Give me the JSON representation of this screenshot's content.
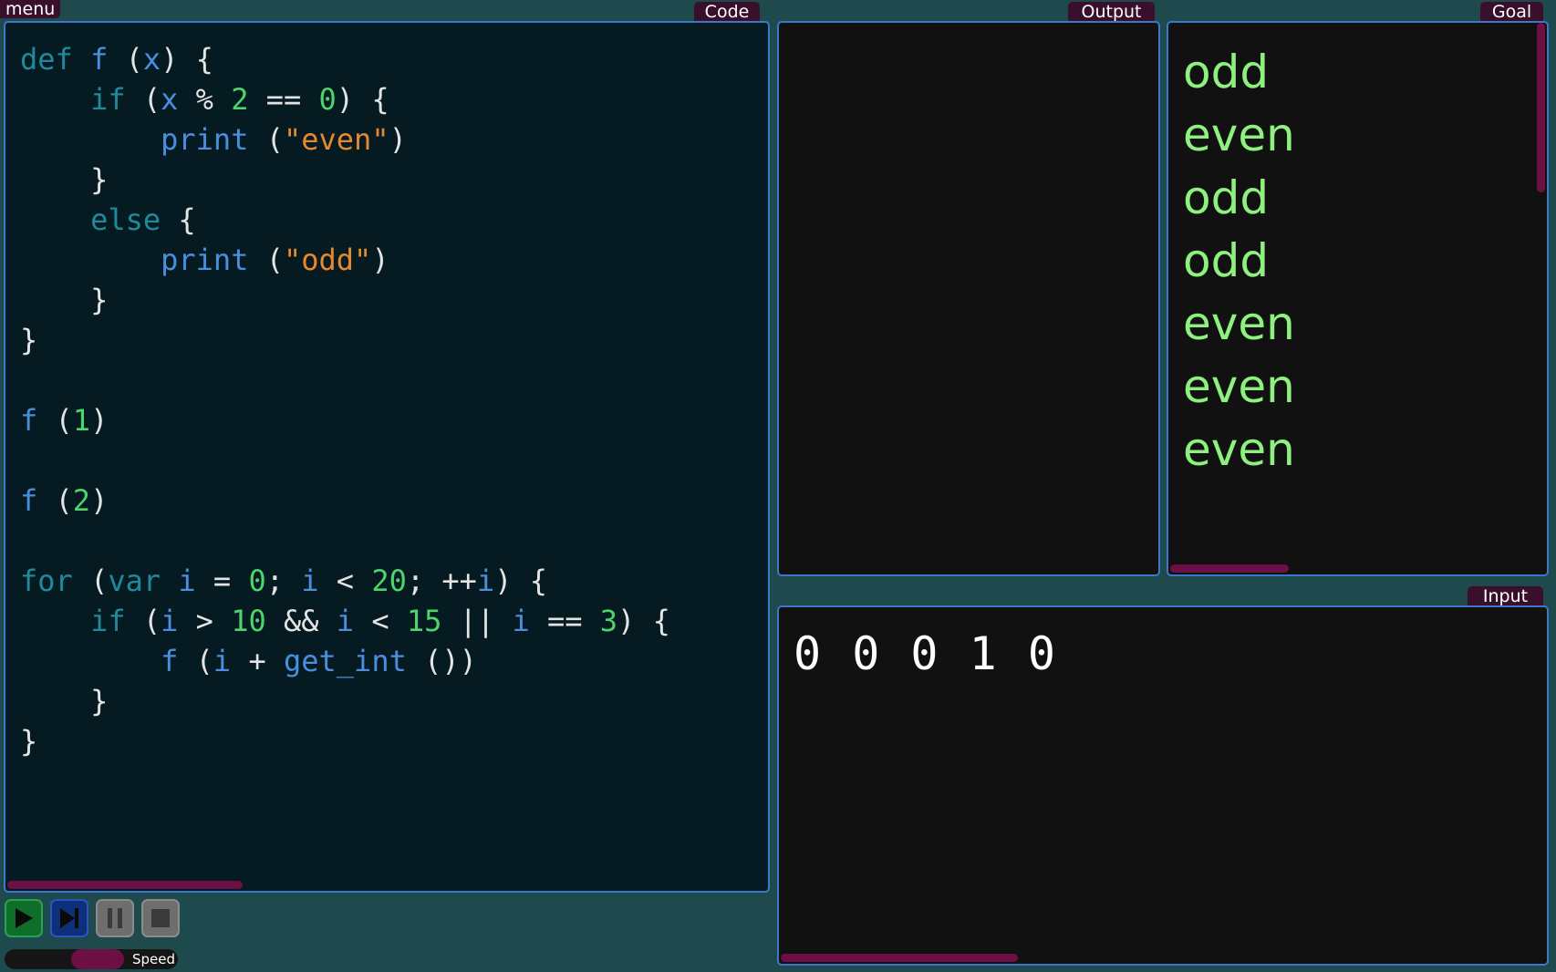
{
  "menu": {
    "label": "menu"
  },
  "tabs": {
    "code": "Code",
    "output": "Output",
    "goal": "Goal",
    "input": "Input"
  },
  "code": {
    "lines": [
      [
        {
          "t": "def",
          "c": "kw"
        },
        {
          "t": " "
        },
        {
          "t": "f",
          "c": "fn"
        },
        {
          "t": " ("
        },
        {
          "t": "x",
          "c": "fn"
        },
        {
          "t": ") {"
        }
      ],
      [
        {
          "t": "    "
        },
        {
          "t": "if",
          "c": "kw"
        },
        {
          "t": " ("
        },
        {
          "t": "x",
          "c": "fn"
        },
        {
          "t": " % "
        },
        {
          "t": "2",
          "c": "num"
        },
        {
          "t": " == "
        },
        {
          "t": "0",
          "c": "num"
        },
        {
          "t": ") {"
        }
      ],
      [
        {
          "t": "        "
        },
        {
          "t": "print",
          "c": "fn"
        },
        {
          "t": " ("
        },
        {
          "t": "\"even\"",
          "c": "str"
        },
        {
          "t": ")"
        }
      ],
      [
        {
          "t": "    }"
        }
      ],
      [
        {
          "t": "    "
        },
        {
          "t": "else",
          "c": "kw"
        },
        {
          "t": " {"
        }
      ],
      [
        {
          "t": "        "
        },
        {
          "t": "print",
          "c": "fn"
        },
        {
          "t": " ("
        },
        {
          "t": "\"odd\"",
          "c": "str"
        },
        {
          "t": ")"
        }
      ],
      [
        {
          "t": "    }"
        }
      ],
      [
        {
          "t": "}"
        }
      ],
      [],
      [
        {
          "t": "f",
          "c": "fn"
        },
        {
          "t": " ("
        },
        {
          "t": "1",
          "c": "num"
        },
        {
          "t": ")"
        }
      ],
      [],
      [
        {
          "t": "f",
          "c": "fn"
        },
        {
          "t": " ("
        },
        {
          "t": "2",
          "c": "num"
        },
        {
          "t": ")"
        }
      ],
      [],
      [
        {
          "t": "for",
          "c": "kw"
        },
        {
          "t": " ("
        },
        {
          "t": "var",
          "c": "kw"
        },
        {
          "t": " "
        },
        {
          "t": "i",
          "c": "fn"
        },
        {
          "t": " = "
        },
        {
          "t": "0",
          "c": "num"
        },
        {
          "t": "; "
        },
        {
          "t": "i",
          "c": "fn"
        },
        {
          "t": " < "
        },
        {
          "t": "20",
          "c": "num"
        },
        {
          "t": "; ++"
        },
        {
          "t": "i",
          "c": "fn"
        },
        {
          "t": ") {"
        }
      ],
      [
        {
          "t": "    "
        },
        {
          "t": "if",
          "c": "kw"
        },
        {
          "t": " ("
        },
        {
          "t": "i",
          "c": "fn"
        },
        {
          "t": " > "
        },
        {
          "t": "10",
          "c": "num"
        },
        {
          "t": " && "
        },
        {
          "t": "i",
          "c": "fn"
        },
        {
          "t": " < "
        },
        {
          "t": "15",
          "c": "num"
        },
        {
          "t": " || "
        },
        {
          "t": "i",
          "c": "fn"
        },
        {
          "t": " == "
        },
        {
          "t": "3",
          "c": "num"
        },
        {
          "t": ") {"
        }
      ],
      [
        {
          "t": "        "
        },
        {
          "t": "f",
          "c": "fn"
        },
        {
          "t": " ("
        },
        {
          "t": "i",
          "c": "fn"
        },
        {
          "t": " + "
        },
        {
          "t": "get_int",
          "c": "fn"
        },
        {
          "t": " ())"
        }
      ],
      [
        {
          "t": "    }"
        }
      ],
      [
        {
          "t": "}"
        }
      ]
    ]
  },
  "output": {
    "lines": []
  },
  "goal": {
    "lines": [
      "odd",
      "even",
      "odd",
      "odd",
      "even",
      "even",
      "even"
    ]
  },
  "input": {
    "text": "0 0 0 1 0"
  },
  "controls": {
    "run_icon": "play-icon",
    "step_icon": "step-forward-icon",
    "pause_icon": "pause-icon",
    "stop_icon": "stop-icon",
    "speed_label": "Speed",
    "speed_level": 0.55
  },
  "colors": {
    "background": "#1e4a4e",
    "panel_border": "#3b78c9",
    "tab": "#3a0f2c",
    "scrollbar": "#6c0f45",
    "goal_text": "#8ef07e",
    "keyword": "#1e8a9a",
    "function": "#4a8ee0",
    "number": "#4dd46a",
    "string": "#e6882e"
  }
}
